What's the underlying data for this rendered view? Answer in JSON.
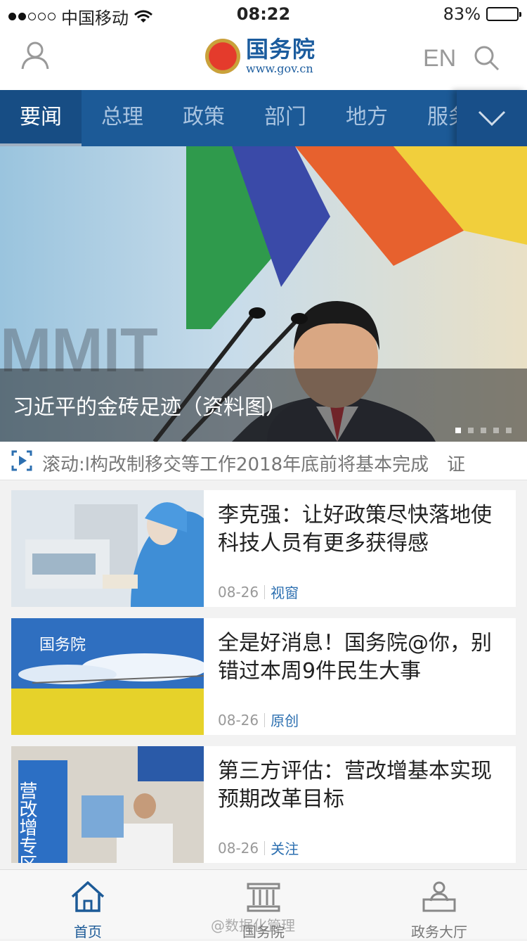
{
  "status_bar": {
    "carrier": "中国移动",
    "time": "08:22",
    "battery": "83%",
    "battery_level": 0.83
  },
  "header": {
    "site_name": "国务院",
    "site_url": "www.gov.cn",
    "lang_label": "EN"
  },
  "nav": {
    "tabs": [
      {
        "label": "要闻",
        "active": true
      },
      {
        "label": "总理",
        "active": false
      },
      {
        "label": "政策",
        "active": false
      },
      {
        "label": "部门",
        "active": false
      },
      {
        "label": "地方",
        "active": false
      },
      {
        "label": "服务",
        "active": false
      }
    ]
  },
  "hero": {
    "caption": "习近平的金砖足迹（资料图）",
    "slide_count": 5,
    "current_slide": 1
  },
  "ticker": {
    "text": "滚动:l构改制移交等工作2018年底前将基本完成　证"
  },
  "news": [
    {
      "title": "李克强：让好政策尽快落地使科技人员有更多获得感",
      "date": "08-26",
      "tag": "视窗"
    },
    {
      "title": "全是好消息！国务院@你，别错过本周9件民生大事",
      "date": "08-26",
      "tag": "原创",
      "thumb_text": "国务院"
    },
    {
      "title": "第三方评估：营改增基本实现预期改革目标",
      "date": "08-26",
      "tag": "关注",
      "thumb_text": "营改增专区"
    }
  ],
  "tabbar": {
    "items": [
      {
        "label": "首页",
        "icon": "home-icon",
        "active": true
      },
      {
        "label": "国务院",
        "icon": "building-icon",
        "active": false
      },
      {
        "label": "政务大厅",
        "icon": "service-hall-icon",
        "active": false
      }
    ]
  },
  "watermark": "@数据化管理",
  "colors": {
    "brand": "#1c5a97",
    "accent": "#2c6fb0"
  }
}
